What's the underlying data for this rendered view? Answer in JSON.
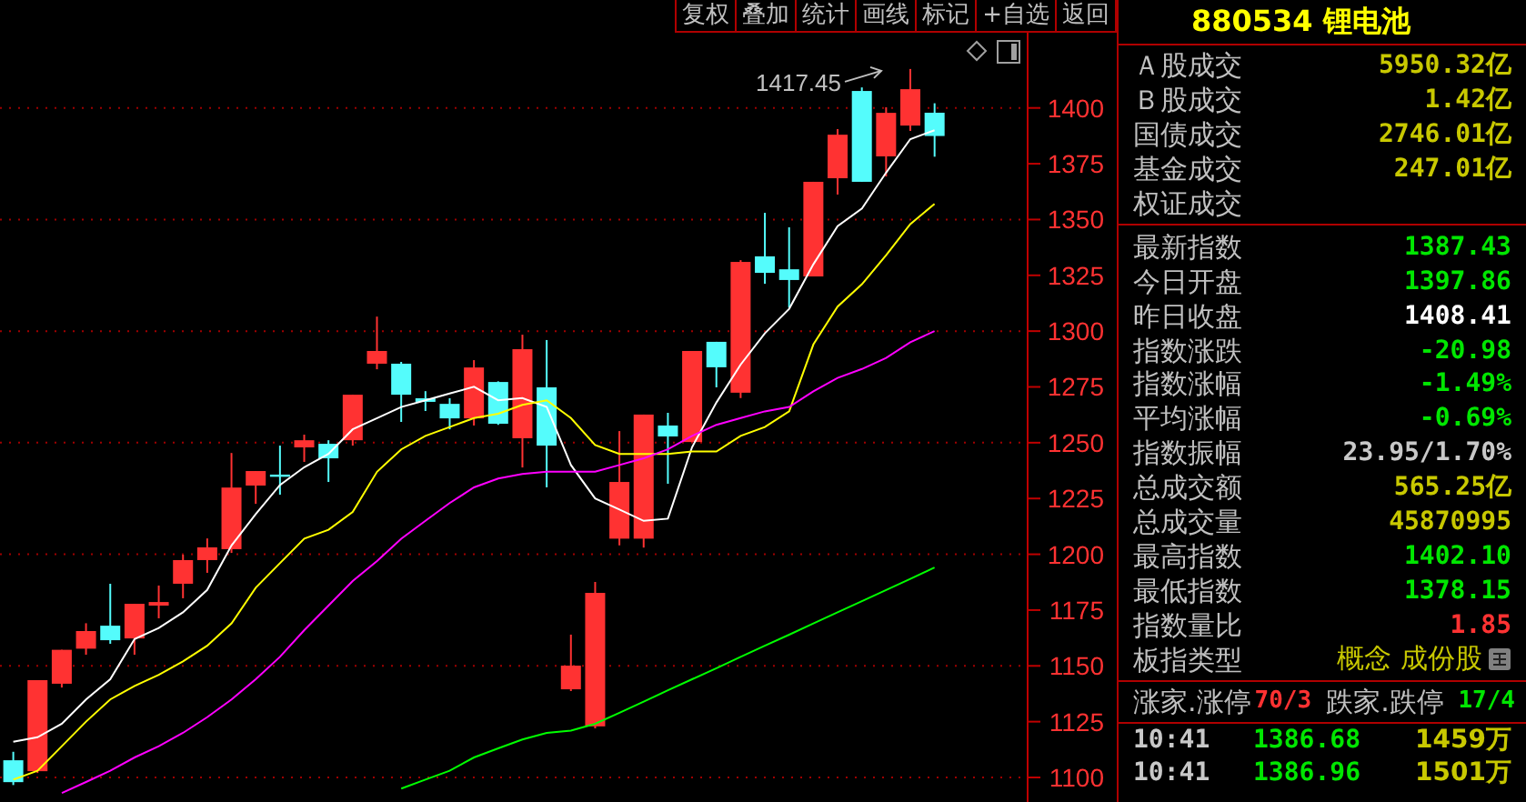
{
  "toolbar": [
    {
      "label": "复权"
    },
    {
      "label": "叠加"
    },
    {
      "label": "统计"
    },
    {
      "label": "画线"
    },
    {
      "label": "标记"
    },
    {
      "label": "+自选"
    },
    {
      "label": "返回"
    }
  ],
  "chart": {
    "chart_data": {
      "type": "candlestick",
      "grid": true,
      "ylim": [
        1089,
        1433.7
      ],
      "yticks": [
        1100,
        1125,
        1150,
        1175,
        1200,
        1225,
        1250,
        1275,
        1300,
        1325,
        1350,
        1375,
        1400
      ],
      "ohlc": [
        [
          1107.7,
          1111.5,
          1096.6,
          1097.9
        ],
        [
          1102.8,
          1143.6,
          1102,
          1143.6
        ],
        [
          1142,
          1157.2,
          1140.3,
          1157.2
        ],
        [
          1157.7,
          1169.1,
          1155,
          1165.6
        ],
        [
          1168,
          1186.8,
          1159.9,
          1161.5
        ],
        [
          1162.3,
          1177.8,
          1155,
          1177.8
        ],
        [
          1177,
          1186,
          1171.3,
          1178.6
        ],
        [
          1186.8,
          1199.8,
          1180.3,
          1197.4
        ],
        [
          1197.4,
          1207.1,
          1191.7,
          1203.1
        ],
        [
          1202.3,
          1245.4,
          1200.6,
          1229.9
        ],
        [
          1230.8,
          1237.3,
          1222.6,
          1237.3
        ],
        [
          1235.7,
          1248.7,
          1226.7,
          1234.8
        ],
        [
          1247.9,
          1253.6,
          1241.4,
          1251.1
        ],
        [
          1249.5,
          1251.1,
          1232.4,
          1243
        ],
        [
          1251.1,
          1271.5,
          1248.7,
          1271.5
        ],
        [
          1285.4,
          1306.5,
          1282.9,
          1291.1
        ],
        [
          1285.4,
          1286.2,
          1259.3,
          1271.5
        ],
        [
          1269.9,
          1273.1,
          1264.2,
          1268.3
        ],
        [
          1267.4,
          1269.9,
          1256,
          1260.9
        ],
        [
          1260.9,
          1287,
          1257.7,
          1283.7
        ],
        [
          1277.2,
          1277.5,
          1258,
          1258.5
        ],
        [
          1252,
          1298.4,
          1238.9,
          1291.9
        ],
        [
          1274.8,
          1296,
          1230,
          1248.7
        ],
        [
          1139.5,
          1164,
          1138.7,
          1150.1
        ],
        [
          1122.9,
          1187.6,
          1122,
          1182.7
        ],
        [
          1207,
          1255.2,
          1204,
          1232.4
        ],
        [
          1207,
          1262.6,
          1203,
          1262.6
        ],
        [
          1257.7,
          1263.4,
          1231.6,
          1252.8
        ],
        [
          1250.3,
          1291.1,
          1250.3,
          1291.1
        ],
        [
          1295.2,
          1295.2,
          1274.8,
          1283.8
        ],
        [
          1272.4,
          1331.8,
          1270,
          1331
        ],
        [
          1333.5,
          1353,
          1321.2,
          1326.1
        ],
        [
          1327.7,
          1346.5,
          1310.6,
          1322.9
        ],
        [
          1324.5,
          1366.9,
          1324.5,
          1366.9
        ],
        [
          1368.5,
          1390.5,
          1361.2,
          1388
        ],
        [
          1407.6,
          1409.2,
          1366.9,
          1366.9
        ],
        [
          1378.3,
          1400.3,
          1369.3,
          1397.8
        ],
        [
          1392.1,
          1417.45,
          1389.7,
          1408.4
        ],
        [
          1397.86,
          1402.1,
          1378.15,
          1387.43
        ]
      ],
      "series": [
        {
          "type": "line",
          "color": "#ffffff",
          "values": [
            1116,
            1118,
            1124,
            1135,
            1144,
            1162,
            1167,
            1174,
            1184,
            1204,
            1218,
            1231,
            1239,
            1245,
            1256,
            1261,
            1266,
            1269,
            1272,
            1275,
            1269,
            1270,
            1266,
            1240,
            1225,
            1220,
            1215,
            1216,
            1248,
            1268,
            1285,
            1299,
            1310,
            1330,
            1347,
            1355,
            1371,
            1386,
            1390
          ]
        },
        {
          "type": "line",
          "color": "#ffff00",
          "values": [
            1099,
            1103,
            1114,
            1125,
            1135,
            1141,
            1146,
            1152,
            1159,
            1169,
            1185,
            1196,
            1207,
            1211,
            1219,
            1237,
            1247,
            1253,
            1257,
            1261,
            1263,
            1267,
            1269,
            1261,
            1249,
            1245,
            1245,
            1245,
            1246,
            1246,
            1253,
            1257,
            1264,
            1294,
            1311,
            1321,
            1334,
            1348,
            1357
          ]
        },
        {
          "type": "line",
          "color": "#ff00ff",
          "values": [
            null,
            null,
            1093,
            1098,
            1103,
            1109,
            1114,
            1120,
            1127,
            1135,
            1144,
            1154,
            1166,
            1177,
            1188,
            1197,
            1207,
            1215,
            1223,
            1230,
            1234,
            1236,
            1237,
            1237,
            1237,
            1240,
            1243,
            1247,
            1253,
            1258,
            1261,
            1264,
            1266,
            1273,
            1279,
            1283,
            1288,
            1295,
            1300
          ]
        },
        {
          "type": "line",
          "color": "#00ff00",
          "values": [
            null,
            null,
            null,
            null,
            null,
            null,
            null,
            null,
            null,
            null,
            null,
            null,
            null,
            null,
            null,
            null,
            1095,
            1099,
            1103,
            1109,
            1113,
            1117,
            1120,
            1121,
            1124,
            1129,
            1134,
            1139,
            1144,
            1149,
            1154,
            1159,
            1164,
            1169,
            1174,
            1179,
            1184,
            1189,
            1194
          ]
        }
      ],
      "annotations": [
        "1417.45"
      ]
    }
  },
  "quote": {
    "code_name": "880534 锂电池",
    "turnover": [
      {
        "label": "Ａ股成交",
        "value": "5950.32亿",
        "color": "#c8c800"
      },
      {
        "label": "Ｂ股成交",
        "value": "1.42亿",
        "color": "#c8c800"
      },
      {
        "label": "国债成交",
        "value": "2746.01亿",
        "color": "#c8c800"
      },
      {
        "label": "基金成交",
        "value": "247.01亿",
        "color": "#c8c800"
      },
      {
        "label": "权证成交"
      }
    ],
    "stats": [
      {
        "label": "最新指数",
        "value": "1387.43",
        "color": "#00e600"
      },
      {
        "label": "今日开盘",
        "value": "1397.86",
        "color": "#00e600"
      },
      {
        "label": "昨日收盘",
        "value": "1408.41",
        "color": "#ffffff"
      },
      {
        "label": "指数涨跌",
        "value": "-20.98",
        "color": "#00e600"
      },
      {
        "label": "指数涨幅",
        "value": "-1.49%",
        "color": "#00e600"
      },
      {
        "label": "平均涨幅",
        "value": "-0.69%",
        "color": "#00e600"
      },
      {
        "label": "指数振幅",
        "value": "23.95/1.70%",
        "color": "#c8c8c8"
      },
      {
        "label": "总成交额",
        "value": "565.25亿",
        "color": "#c8c800"
      },
      {
        "label": "总成交量",
        "value": "45870995",
        "color": "#c8c800"
      },
      {
        "label": "最高指数",
        "value": "1402.10",
        "color": "#00e600"
      },
      {
        "label": "最低指数",
        "value": "1378.15",
        "color": "#00e600"
      },
      {
        "label": "指数量比",
        "value": "1.85",
        "color": "#ff3232"
      }
    ],
    "sector_type": {
      "label": "板指类型",
      "value": "概念 成份股"
    },
    "breadth": [
      {
        "label": "涨家.涨停",
        "value": "70/3",
        "color": "#ff3232"
      },
      {
        "label": "跌家.跌停",
        "value": "17/4",
        "color": "#00e600"
      }
    ]
  },
  "ticks": [
    {
      "time": "10:41",
      "price": "1386.68",
      "volume": "1459万"
    },
    {
      "time": "10:41",
      "price": "1386.96",
      "volume": "1501万"
    }
  ]
}
